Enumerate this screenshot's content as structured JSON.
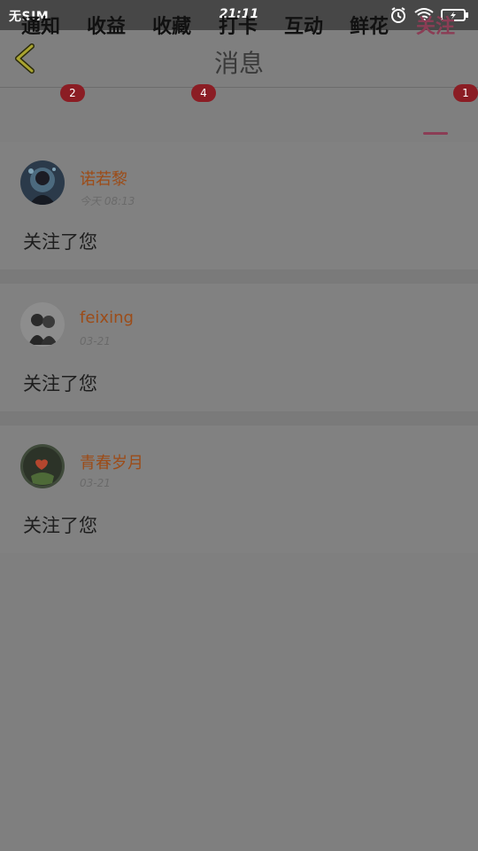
{
  "status_bar": {
    "carrier": "无SIM",
    "time": "21:11",
    "icons": [
      "alarm-icon",
      "wifi-icon",
      "battery-charging-icon"
    ]
  },
  "header": {
    "title": "消息",
    "back_icon": "chevron-left-icon"
  },
  "tabs": [
    {
      "label": "通知",
      "badge": "2"
    },
    {
      "label": "收益",
      "badge": ""
    },
    {
      "label": "收藏",
      "badge": "4"
    },
    {
      "label": "打卡",
      "badge": ""
    },
    {
      "label": "互动",
      "badge": ""
    },
    {
      "label": "鲜花",
      "badge": ""
    },
    {
      "label": "关注",
      "badge": "1",
      "active": true
    }
  ],
  "messages": [
    {
      "name": "诺若黎",
      "time": "今天 08:13",
      "text": "关注了您"
    },
    {
      "name": "feixing",
      "time": "03-21",
      "text": "关注了您"
    },
    {
      "name": "青春岁月",
      "time": "03-21",
      "text": "关注了您"
    }
  ],
  "colors": {
    "accent": "#8b3d55",
    "badge": "#8b1d24",
    "name": "#9c4c18",
    "overlay_bg": "#7f7f7f"
  }
}
